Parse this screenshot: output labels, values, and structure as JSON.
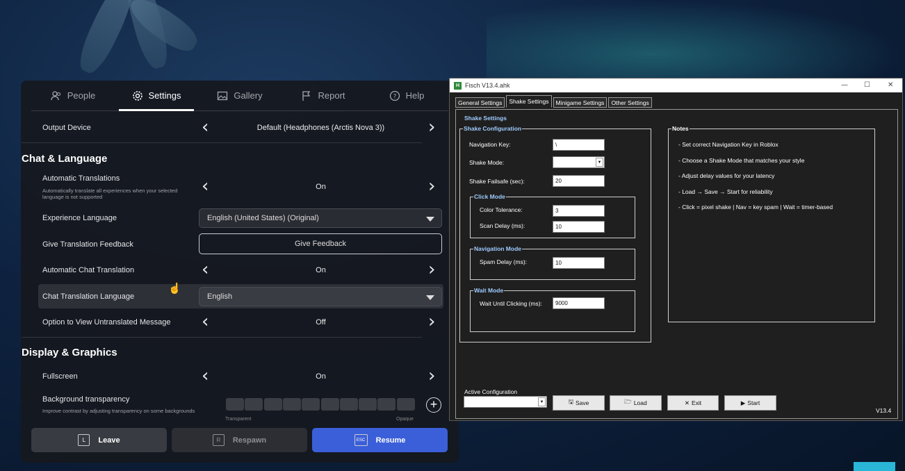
{
  "roblox": {
    "tabs": [
      {
        "label": "People",
        "icon": "people-icon"
      },
      {
        "label": "Settings",
        "icon": "gear-icon"
      },
      {
        "label": "Gallery",
        "icon": "image-icon"
      },
      {
        "label": "Report",
        "icon": "flag-icon"
      },
      {
        "label": "Help",
        "icon": "help-icon"
      }
    ],
    "output_device": {
      "label": "Output Device",
      "value": "Default (Headphones (Arctis Nova 3))"
    },
    "section_chat": "Chat & Language",
    "auto_translations": {
      "label": "Automatic Translations",
      "sub": "Automatically translate all experiences when your selected language is not supported",
      "value": "On"
    },
    "experience_language": {
      "label": "Experience Language",
      "value": "English (United States) (Original)"
    },
    "translation_feedback": {
      "label": "Give Translation Feedback",
      "button": "Give Feedback"
    },
    "auto_chat_translation": {
      "label": "Automatic Chat Translation",
      "value": "On"
    },
    "chat_translation_language": {
      "label": "Chat Translation Language",
      "value": "English"
    },
    "untranslated": {
      "label": "Option to View Untranslated Message",
      "value": "Off"
    },
    "section_display": "Display & Graphics",
    "fullscreen": {
      "label": "Fullscreen",
      "value": "On"
    },
    "bg_transparency": {
      "label": "Background transparency",
      "sub": "Improve contrast by adjusting transparency on some backgrounds",
      "left": "Transparent",
      "right": "Opaque",
      "level": 0
    },
    "buttons": {
      "leave": "Leave",
      "leave_key": "L",
      "respawn": "Respawn",
      "respawn_key": "R",
      "resume": "Resume",
      "resume_key": "ESC"
    },
    "colors": {
      "accent": "#3b5fd9"
    }
  },
  "ahk": {
    "title": "Fisch V13.4.ahk",
    "tabs": [
      "General Settings",
      "Shake Settings",
      "Minigame Settings",
      "Other Settings"
    ],
    "active_tab": "Shake Settings",
    "page_title": "Shake Settings",
    "shake_config": {
      "title": "Shake Configuration",
      "nav_key_label": "Navigation Key:",
      "nav_key_value": "\\",
      "shake_mode_label": "Shake Mode:",
      "shake_mode_value": "",
      "failsafe_label": "Shake Failsafe (sec):",
      "failsafe_value": "20"
    },
    "click_mode": {
      "title": "Click Mode",
      "tolerance_label": "Color Tolerance:",
      "tolerance_value": "3",
      "scan_label": "Scan Delay (ms):",
      "scan_value": "10"
    },
    "nav_mode": {
      "title": "Navigation Mode",
      "spam_label": "Spam Delay (ms):",
      "spam_value": "10"
    },
    "wait_mode": {
      "title": "Wait Mode",
      "wait_label": "Wait Until Clicking (ms):",
      "wait_value": "9000"
    },
    "notes": {
      "title": "Notes",
      "items": [
        "- Set correct Navigation Key in Roblox",
        "- Choose a Shake Mode that matches your style",
        "- Adjust delay values for your latency",
        "- Load → Save → Start for reliability",
        "- Click = pixel shake | Nav = key spam | Wait = timer-based"
      ]
    },
    "active_config_label": "Active Configuration",
    "active_config_value": "",
    "buttons": {
      "save": "Save",
      "load": "Load",
      "exit": "Exit",
      "start": "Start"
    },
    "version": "V13.4"
  }
}
